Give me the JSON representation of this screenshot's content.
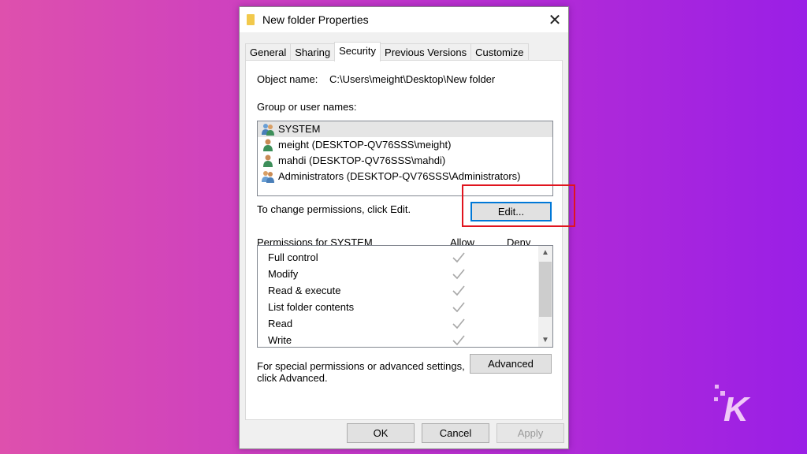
{
  "dialog": {
    "title": "New folder Properties",
    "close_label": "✕",
    "tabs": [
      {
        "label": "General",
        "active": false
      },
      {
        "label": "Sharing",
        "active": false
      },
      {
        "label": "Security",
        "active": true
      },
      {
        "label": "Previous Versions",
        "active": false
      },
      {
        "label": "Customize",
        "active": false
      }
    ]
  },
  "security": {
    "object_name_label": "Object name:",
    "object_name_value": "C:\\Users\\meight\\Desktop\\New folder",
    "group_label": "Group or user names:",
    "users": [
      {
        "name": "SYSTEM",
        "icon": "group-icon",
        "selected": true
      },
      {
        "name": "meight (DESKTOP-QV76SSS\\meight)",
        "icon": "user-icon",
        "selected": false
      },
      {
        "name": "mahdi (DESKTOP-QV76SSS\\mahdi)",
        "icon": "user-icon",
        "selected": false
      },
      {
        "name": "Administrators (DESKTOP-QV76SSS\\Administrators)",
        "icon": "group-icon",
        "selected": false
      }
    ],
    "change_hint": "To change permissions, click Edit.",
    "edit_button": "Edit...",
    "permissions_label": "Permissions for SYSTEM",
    "allow_header": "Allow",
    "deny_header": "Deny",
    "permissions": [
      {
        "name": "Full control",
        "allow": true,
        "deny": false
      },
      {
        "name": "Modify",
        "allow": true,
        "deny": false
      },
      {
        "name": "Read & execute",
        "allow": true,
        "deny": false
      },
      {
        "name": "List folder contents",
        "allow": true,
        "deny": false
      },
      {
        "name": "Read",
        "allow": true,
        "deny": false
      },
      {
        "name": "Write",
        "allow": true,
        "deny": false
      }
    ],
    "advanced_hint_line1": "For special permissions or advanced settings,",
    "advanced_hint_line2": "click Advanced.",
    "advanced_button": "Advanced"
  },
  "footer": {
    "ok": "OK",
    "cancel": "Cancel",
    "apply": "Apply"
  },
  "colors": {
    "highlight_box": "#e0141e",
    "focus_border": "#0078d7",
    "background_left": "#de50ad",
    "background_right": "#9a1fe6"
  },
  "watermark": "K"
}
